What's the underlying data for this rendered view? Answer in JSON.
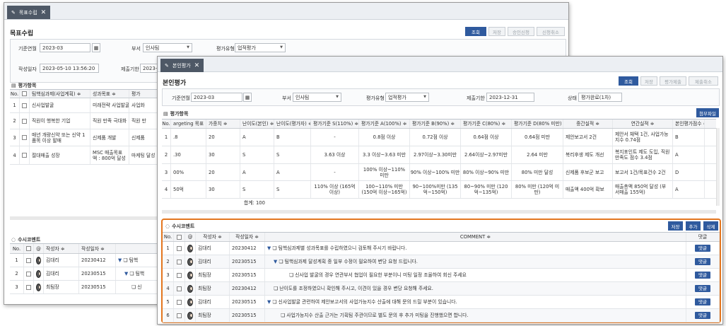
{
  "back": {
    "tab_label": "목표수립",
    "title": "목표수립",
    "buttons": [
      "조회",
      "저장",
      "승인신청",
      "신청취소"
    ],
    "filter": {
      "base_month_label": "기준연월",
      "base_month": "2023-03",
      "dept_label": "부서",
      "dept": "인사팀",
      "eval_type_label": "평가유형",
      "eval_type": "업적평가",
      "author_date_label": "작성일자",
      "author_date": "2023-05-10 13:56:20",
      "due_label": "제출기한",
      "due_partial": "2023-12-"
    },
    "items_title": "평가항목",
    "items_headers": [
      "No.",
      "",
      "팀핵심과제(사업계획) ≑",
      "성과목표 ≑",
      "평가"
    ],
    "items_rows": [
      {
        "no": "1",
        "task": "신사업발굴",
        "goal": "미래전략 사업발굴",
        "eval": "사업화"
      },
      {
        "no": "2",
        "task": "직원이 행복한 기업",
        "goal": "직원 만족 극대화",
        "eval": "직원 만"
      },
      {
        "no": "3",
        "task": "매년 개량신약 또는 신약 1품목 이상 발매",
        "goal": "신제품 개발",
        "eval": "신제품"
      },
      {
        "no": "4",
        "task": "절대매출 성장",
        "goal": "MSC 매출목표액 : 800억 달성",
        "eval": "마케팅 달성"
      }
    ],
    "comments_title": "수시코멘트",
    "comments_headers": [
      "No.",
      "",
      "@",
      "작성자 ≑",
      "작성일자 ≑"
    ],
    "comments_rows": [
      {
        "no": "1",
        "author": "김대리",
        "date": "20230412",
        "text": "팀핵"
      },
      {
        "no": "2",
        "author": "김대리",
        "date": "20230515",
        "text": "팀핵"
      },
      {
        "no": "3",
        "author": "최팀장",
        "date": "20230515",
        "text": "신"
      }
    ]
  },
  "front": {
    "tab_label": "본인평가",
    "title": "본인평가",
    "buttons": [
      "조회",
      "저장",
      "평가제출",
      "제출취소"
    ],
    "filter": {
      "base_month_label": "기준연월",
      "base_month": "2023-03",
      "dept_label": "부서",
      "dept": "인사팀",
      "eval_type_label": "평가유형",
      "eval_type": "업적평가",
      "due_label": "제출기한",
      "due": "2023-12-31",
      "status_label": "상태",
      "status": "평가완료(1차)"
    },
    "items_title": "평가항목",
    "attach_button": "첨부파일",
    "items_headers": [
      "No.",
      "argeting 목표",
      "가중치 ≑",
      "난이도(본인) ≑",
      "난이도(평가자) ≑",
      "평가기준 S(110%) ≑",
      "평가기준 A(100%) ≑",
      "평가기준 B(90%) ≑",
      "평가기준 C(80%) ≑",
      "평가기준 D(80% 미만) ≑",
      "중간실적 ≑",
      "연간실적 ≑",
      "본인평가점수 ≑"
    ],
    "items_rows": [
      {
        "no": "1",
        "target": ".8",
        "weight": "20",
        "d_self": "A",
        "d_eval": "B",
        "s": "-",
        "a": "0.8점 이상",
        "b": "0.72점 이상",
        "c": "0.64점 이상",
        "d": "0.64점 미만",
        "mid": "제안보고서 2건",
        "annual": "제안서 채택 1건, 사업가능지수 0.74점",
        "score": "B"
      },
      {
        "no": "2",
        "target": ".30",
        "weight": "30",
        "d_self": "S",
        "d_eval": "S",
        "s": "3.63 이상",
        "a": "3.3 이상~3.63 미만",
        "b": "2.97이상~3.30미만",
        "c": "2.64이상~2.97미만",
        "d": "2.64 미만",
        "mid": "복리후생 제도 개선",
        "annual": "복지포인트 제도 도입, 직원만족도 점수 3.4점",
        "score": "A"
      },
      {
        "no": "3",
        "target": "00%",
        "weight": "20",
        "d_self": "A",
        "d_eval": "A",
        "s": "-",
        "a": "100% 이상~110% 미만",
        "b": "90% 이상~100% 미만",
        "c": "80% 이상~90% 미만",
        "d": "80% 미만 달성",
        "mid": "신제품 후보군 보고",
        "annual": "보고서 1건/목표건수 2건",
        "score": "D"
      },
      {
        "no": "4",
        "target": "50억",
        "weight": "30",
        "d_self": "S",
        "d_eval": "S",
        "s": "110% 이상 (165억 이상)",
        "a": "100~110% 미만 (150억 이상~165억)",
        "b": "90~100%미만 (135억~150억)",
        "c": "80~90% 미만 (120억~135억)",
        "d": "80% 미만 (120억 미만)",
        "mid": "매출액 400억 확보",
        "annual": "매출총액 850억 달성 (부서매출 155억)",
        "score": "A"
      }
    ],
    "total_label": "합계: 100",
    "comments_title": "수시코멘트",
    "comments_buttons": [
      "저장",
      "추가",
      "삭제"
    ],
    "comments_headers": [
      "No.",
      "",
      "@",
      "작성자 ≑",
      "작성일자 ≑",
      "COMMENT ≑",
      "댓글"
    ],
    "comments_rows": [
      {
        "no": "1",
        "author": "김대리",
        "date": "20230412",
        "text": "팀핵심과제별 성과목표를 수립하였으니 검토해 주시기 바랍니다.",
        "level": 0,
        "reply": "댓글"
      },
      {
        "no": "2",
        "author": "김대리",
        "date": "20230515",
        "text": "팀핵심과제 달성계획 중 일부 수정이 필요하여 변당 요청 드립니다.",
        "level": 1,
        "reply": "댓글"
      },
      {
        "no": "3",
        "author": "최팀장",
        "date": "20230515",
        "text": "신사업 발굴의 경우 연관부서 협업이 필요한 부분이니 미팅 일정 조율하여 회신 주세요",
        "level": 2,
        "reply": "댓글"
      },
      {
        "no": "4",
        "author": "최팀장",
        "date": "20230412",
        "text": "난이도를 조정하였으니 확인해 주시고, 이견이 있을 경우 변당 요청해 주세요.",
        "level": 0,
        "reply": "댓글"
      },
      {
        "no": "5",
        "author": "김대리",
        "date": "20230515",
        "text": "신사업발굴 관련하여 제안보고서의 사업가능지수 산출에 대해 문의 드릴 부분이 있습니다.",
        "level": 0,
        "reply": "댓글"
      },
      {
        "no": "6",
        "author": "최팀장",
        "date": "20230515",
        "text": "사업가능지수 산출 근거는 기획팀 주관이므로 별도 문의 후 추가 미팅을 진행했으면 합니다.",
        "level": 1,
        "reply": "댓글"
      }
    ]
  },
  "colors": {
    "primary": "#2f5a9e",
    "highlight": "#e3761f",
    "tab": "#4e5866"
  }
}
